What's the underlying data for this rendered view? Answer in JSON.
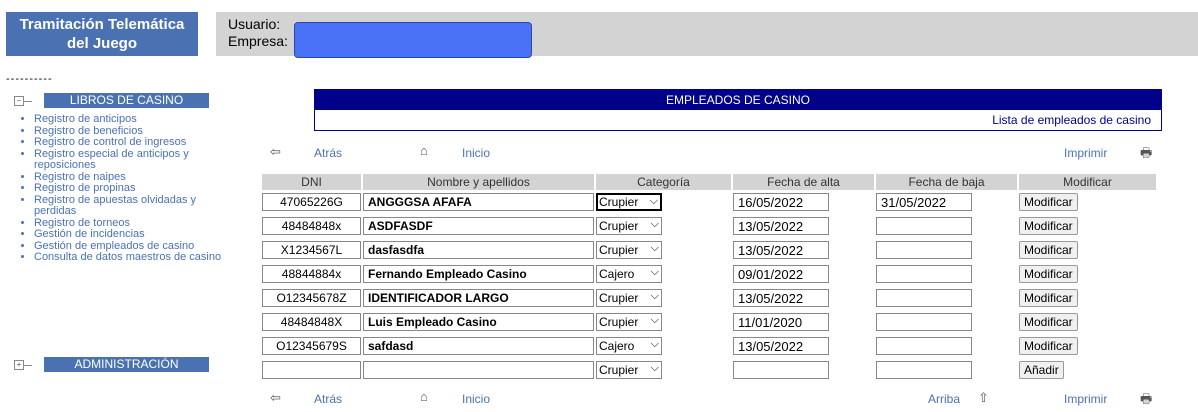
{
  "header": {
    "app_title_line1": "Tramitación Telemática",
    "app_title_line2": "del Juego",
    "usuario_label": "Usuario:",
    "empresa_label": "Empresa:"
  },
  "sidebar": {
    "dashes": "----------",
    "sections": [
      {
        "label": "LIBROS DE CASINO",
        "expand_symbol": "−"
      },
      {
        "label": "ADMINISTRACIÓN",
        "expand_symbol": "+"
      }
    ],
    "items": [
      "Registro de anticipos",
      "Registro de beneficios",
      "Registro de control de ingresos",
      "Registro especial de anticipos y reposiciones",
      "Registro de naipes",
      "Registro de propinas",
      "Registro de apuestas olvidadas y perdidas",
      "Registro de torneos",
      "Gestión de incidencias",
      "Gestión de empleados de casino",
      "Consulta de datos maestros de casino"
    ]
  },
  "main": {
    "title": "EMPLEADOS DE CASINO",
    "subtitle": "Lista de empleados de casino",
    "nav": {
      "atras": "Atrás",
      "inicio": "Inicio",
      "imprimir": "Imprimir",
      "arriba": "Arriba"
    },
    "columns": [
      "DNI",
      "Nombre y apellidos",
      "Categoría",
      "Fecha de alta",
      "Fecha de baja",
      "Modificar"
    ],
    "rows": [
      {
        "dni": "47065226G",
        "nombre": "ANGGGSA AFAFA",
        "categoria": "Crupier",
        "alta": "16/05/2022",
        "baja": "31/05/2022",
        "button": "Modificar"
      },
      {
        "dni": "48484848x",
        "nombre": "ASDFASDF",
        "categoria": "Crupier",
        "alta": "13/05/2022",
        "baja": "",
        "button": "Modificar"
      },
      {
        "dni": "X1234567L",
        "nombre": "dasfasdfa",
        "categoria": "Crupier",
        "alta": "13/05/2022",
        "baja": "",
        "button": "Modificar"
      },
      {
        "dni": "48844884x",
        "nombre": "Fernando Empleado Casino",
        "categoria": "Cajero",
        "alta": "09/01/2022",
        "baja": "",
        "button": "Modificar"
      },
      {
        "dni": "O12345678Z",
        "nombre": "IDENTIFICADOR LARGO",
        "categoria": "Crupier",
        "alta": "13/05/2022",
        "baja": "",
        "button": "Modificar"
      },
      {
        "dni": "48484848X",
        "nombre": "Luis Empleado Casino",
        "categoria": "Crupier",
        "alta": "11/01/2020",
        "baja": "",
        "button": "Modificar"
      },
      {
        "dni": "O12345679S",
        "nombre": "safdasd",
        "categoria": "Cajero",
        "alta": "13/05/2022",
        "baja": "",
        "button": "Modificar"
      }
    ],
    "new_row": {
      "categoria": "Crupier",
      "button": "Añadir"
    }
  },
  "colors": {
    "header_blue": "#4a72b3",
    "banner_navy": "#00008b",
    "grey_bar": "#d3d3d3",
    "redaction": "#4a72f6"
  }
}
